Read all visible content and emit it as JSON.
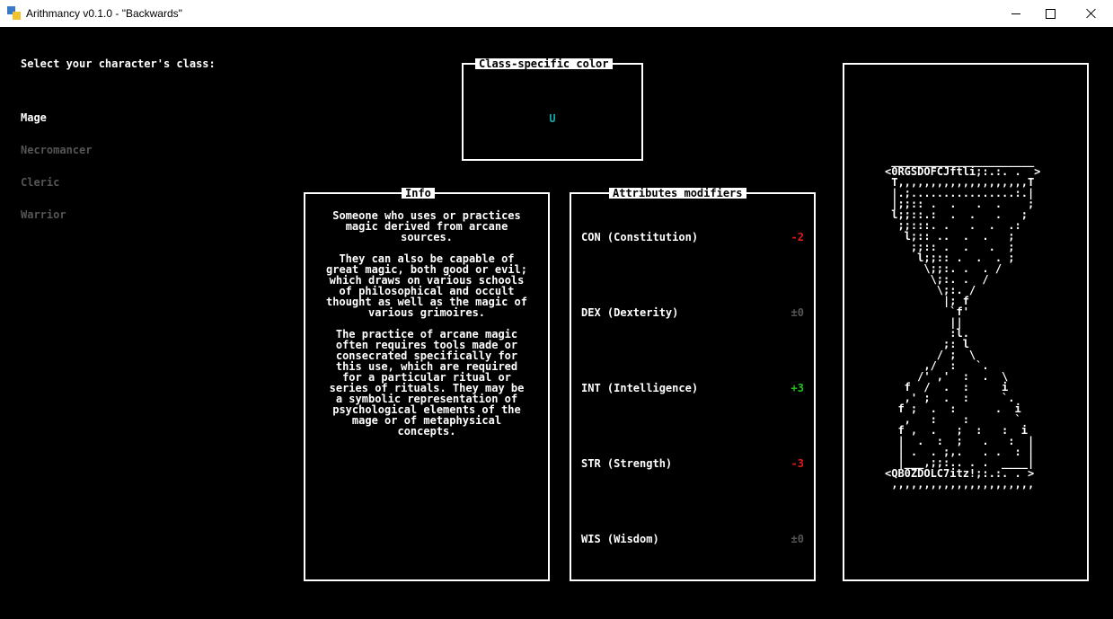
{
  "window": {
    "title": "Arithmancy v0.1.0 - \"Backwards\"",
    "icon": "python-icon",
    "controls": [
      "minimize-icon",
      "maximize-icon",
      "close-icon"
    ]
  },
  "class_select": {
    "prompt": "Select your character's class:",
    "options": [
      "Mage",
      "Necromancer",
      "Cleric",
      "Warrior"
    ],
    "selected": "Mage"
  },
  "class_color": {
    "title": "Class-specific color",
    "glyph": "U",
    "color": "#17a8a8"
  },
  "info": {
    "title": "Info",
    "paragraphs": [
      "Someone who uses or practices\nmagic derived from arcane\nsources.",
      "They can also be capable of\ngreat magic, both good or evil;\nwhich draws on various schools\nof philosophical and occult\nthought as well as the magic of\nvarious grimoires.",
      "The practice of arcane magic\noften requires tools made or\nconsecrated specifically for\nthis use, which are required\nfor a particular ritual or\nseries of rituals. They may be\na symbolic representation of\npsychological elements of the\nmage or of metaphysical\nconcepts."
    ]
  },
  "attributes": {
    "title": "Attributes modifiers",
    "items": [
      {
        "name": "CON (Constitution)",
        "value": "-2",
        "color": "#e01b1b"
      },
      {
        "name": "DEX (Dexterity)",
        "value": "±0",
        "color": "#555555"
      },
      {
        "name": "INT (Intelligence)",
        "value": "+3",
        "color": "#1fc21f"
      },
      {
        "name": "STR (Strength)",
        "value": "-3",
        "color": "#e01b1b"
      },
      {
        "name": "WIS (Wisdom)",
        "value": "±0",
        "color": "#555555"
      }
    ]
  },
  "hourglass": {
    "art": " ______________________\n<0RGSDOFCJftli;:.:. .  >\n T,,,,,,,,,,,,,,,,,,,,T\n |.;................:.|\n |;;:: .  .   .  .    ;\n l;;::.:  .  .   .   ;\n  ;;:::. .   .  .  .:\n   l;:: ..  .  .   ;\n    ;;:: .  .   .  ;\n     l;;:: .  .  . ;\n      \\;;:. .  . /\n       \\;:. .  /\n        \\;:. /\n         |; f\n          `f'\n          ||\n          :l.\n         ;: l\n        / ;  \\\n      ,/  :   `.\n     /' ,'  :  .  \\\n   f  /  .  :     i\n   ,' ;  .  :     `.\n  f ;  .  :      .  i\n   ,   :    :       `\n  f ,  .   ;  :   :  i\n  |  .  :  ;   .   :  |\n  | .  . ;,.   . .  : |\n  |___,;;:.. . .  ____|\n<QB0ZDOLC7itz!;:.:. . >\n ,,,,,,,,,,,,,,,,,,,,,,"
  }
}
